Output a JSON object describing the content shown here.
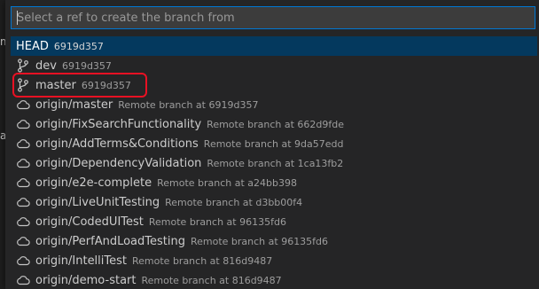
{
  "background": {
    "left_glyphs": [
      "m",
      "a"
    ]
  },
  "picker": {
    "search": {
      "placeholder": "Select a ref to create the branch from",
      "value": ""
    },
    "items": [
      {
        "icon": "none",
        "label": "HEAD",
        "description": "6919d357",
        "selected": true
      },
      {
        "icon": "branch-icon",
        "label": "dev",
        "description": "6919d357"
      },
      {
        "icon": "branch-icon",
        "label": "master",
        "description": "6919d357",
        "highlighted": true
      },
      {
        "icon": "cloud-icon",
        "label": "origin/master",
        "description": "Remote branch at 6919d357"
      },
      {
        "icon": "cloud-icon",
        "label": "origin/FixSearchFunctionality",
        "description": "Remote branch at 662d9fde"
      },
      {
        "icon": "cloud-icon",
        "label": "origin/AddTerms&Conditions",
        "description": "Remote branch at 9da57edd"
      },
      {
        "icon": "cloud-icon",
        "label": "origin/DependencyValidation",
        "description": "Remote branch at 1ca13fb2"
      },
      {
        "icon": "cloud-icon",
        "label": "origin/e2e-complete",
        "description": "Remote branch at a24bb398"
      },
      {
        "icon": "cloud-icon",
        "label": "origin/LiveUnitTesting",
        "description": "Remote branch at d3bb00f4"
      },
      {
        "icon": "cloud-icon",
        "label": "origin/CodedUITest",
        "description": "Remote branch at 96135fd6"
      },
      {
        "icon": "cloud-icon",
        "label": "origin/PerfAndLoadTesting",
        "description": "Remote branch at 96135fd6"
      },
      {
        "icon": "cloud-icon",
        "label": "origin/IntelliTest",
        "description": "Remote branch at 816d9487"
      },
      {
        "icon": "cloud-icon",
        "label": "origin/demo-start",
        "description": "Remote branch at 816d9487"
      }
    ]
  },
  "colors": {
    "accent": "#0078d4",
    "selection": "#04395e",
    "highlight": "#e81123"
  }
}
